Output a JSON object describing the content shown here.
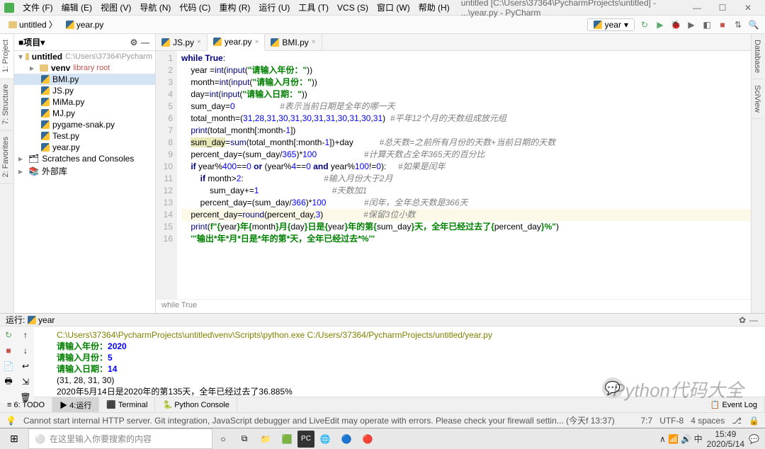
{
  "menu": {
    "items": [
      "文件 (F)",
      "编辑 (E)",
      "视图 (V)",
      "导航 (N)",
      "代码 (C)",
      "重构 (R)",
      "运行 (U)",
      "工具 (T)",
      "VCS (S)",
      "窗口 (W)",
      "帮助 (H)"
    ],
    "title": "untitled [C:\\Users\\37364\\PycharmProjects\\untitled] - ...\\year.py - PyCharm"
  },
  "crumb": {
    "dir": "untitled",
    "file": "year.py"
  },
  "run_config": "year",
  "project": {
    "title": "项目",
    "root": {
      "name": "untitled",
      "path": "C:\\Users\\37364\\Pycharm"
    },
    "venv": {
      "name": "venv",
      "note": "library root"
    },
    "files": [
      "BMI.py",
      "JS.py",
      "MiMa.py",
      "MJ.py",
      "pygame-snak.py",
      "Test.py",
      "year.py"
    ],
    "scratches": "Scratches and Consoles",
    "ext": "外部库"
  },
  "tabs": [
    {
      "name": "JS.py"
    },
    {
      "name": "year.py"
    },
    {
      "name": "BMI.py"
    }
  ],
  "code_lines": [
    {
      "n": 1,
      "html": "<span class='kw'>while</span> <span class='kw'>True</span>:"
    },
    {
      "n": 2,
      "html": "    year =<span class='builtin'>int</span>(<span class='builtin'>input</span>(<span class='str'>\"请输入年份：\"</span>))"
    },
    {
      "n": 3,
      "html": "    month=<span class='builtin'>int</span>(<span class='builtin'>input</span>(<span class='str'>\"请输入月份：\"</span>))"
    },
    {
      "n": 4,
      "html": "    day=<span class='builtin'>int</span>(<span class='builtin'>input</span>(<span class='str'>\"请输入日期：\"</span>))"
    },
    {
      "n": 5,
      "html": "    sum_day=<span class='num'>0</span>                   <span class='cmt'>#表示当前日期是全年的哪一天</span>"
    },
    {
      "n": 6,
      "html": "    total_month=(<span class='num'>31</span>,<span class='num'>28</span>,<span class='num'>31</span>,<span class='num'>30</span>,<span class='num'>31</span>,<span class='num'>30</span>,<span class='num'>31</span>,<span class='num'>31</span>,<span class='num'>30</span>,<span class='num'>31</span>,<span class='num'>30</span>,<span class='num'>31</span>)  <span class='cmt'>#平年12个月的天数组成放元组</span>"
    },
    {
      "n": 7,
      "html": "    <span class='builtin'>print</span>(total_month[:month-<span class='num'>1</span>])"
    },
    {
      "n": 8,
      "html": "    <span class='hl-sym'>sum_day</span>=<span class='builtin'>sum</span>(total_month[:month-<span class='num'>1</span>])+day           <span class='cmt'>#总天数=之前所有月份的天数+当前日期的天数</span>"
    },
    {
      "n": 9,
      "html": "    percent_day=(sum_day/<span class='num'>365</span>)*<span class='num'>100</span>                    <span class='cmt'>#计算天数占全年365天的百分比</span>"
    },
    {
      "n": 10,
      "html": "    <span class='kw'>if</span> year%<span class='num'>400</span>==<span class='num'>0</span> <span class='kw'>or</span> (year%<span class='num'>4</span>==<span class='num'>0</span> <span class='kw'>and</span> year%<span class='num'>100</span>!=<span class='num'>0</span>):     <span class='cmt'>#如果是闰年</span>"
    },
    {
      "n": 11,
      "html": "        <span class='kw'>if</span> month&gt;<span class='num'>2</span>:                                  <span class='cmt'>#输入月份大于2月</span>"
    },
    {
      "n": 12,
      "html": "            sum_day+=<span class='num'>1</span>                               <span class='cmt'>#天数加1</span>"
    },
    {
      "n": 13,
      "html": "        percent_day=(sum_day/<span class='num'>366</span>)*<span class='num'>100</span>                <span class='cmt'>#闰年，全年总天数是366天</span>"
    },
    {
      "n": 14,
      "html": "    percent_day=<span class='builtin'>round</span>(percent_day,<span class='num'>3</span>)                 <span class='cmt'>#保留3位小数</span>",
      "hl": true
    },
    {
      "n": 15,
      "html": "    <span class='builtin'>print</span>(<span class='str'>f\"{</span>year<span class='str'>}年{</span>month<span class='str'>}月{</span>day<span class='str'>}日是{</span>year<span class='str'>}年的第{</span>sum_day<span class='str'>}天，全年已经过去了{</span>percent_day<span class='str'>}%\"</span>)"
    },
    {
      "n": 16,
      "html": "    <span class='str'>'''输出*年*月*日是*年的第*天，全年已经过去*%'''</span>"
    }
  ],
  "breadcrumb": "while True",
  "run": {
    "title": "运行:",
    "config": "year",
    "lines": [
      "<span class='path'>C:\\Users\\37364\\PycharmProjects\\untitled\\venv\\Scripts\\python.exe C:/Users/37364/PycharmProjects/untitled/year.py</span>",
      "<span class='inp'>请输入年份：</span><span class='num2'>2020</span>",
      "<span class='inp'>请输入月份：</span><span class='num2'>5</span>",
      "<span class='inp'>请输入日期：</span><span class='num2'>14</span>",
      "(31, 28, 31, 30)",
      "2020年5月14日是2020年的第135天，全年已经过去了36.885%"
    ]
  },
  "bottom_tabs": [
    "≡ 6: TODO",
    "▶ 4:运行",
    "⬛ Terminal",
    "🐍 Python Console"
  ],
  "status": {
    "msg": "Cannot start internal HTTP server. Git integration, JavaScript debugger and LiveEdit may operate with errors. Please check your firewall settin... (今天f 13:37)",
    "pos": "7:7",
    "enc": "UTF-8",
    "indent": "4 spaces"
  },
  "taskbar": {
    "search": "在这里输入你要搜索的内容",
    "time": "15:49",
    "date": "2020/5/14"
  },
  "watermark": "Python代码大全"
}
